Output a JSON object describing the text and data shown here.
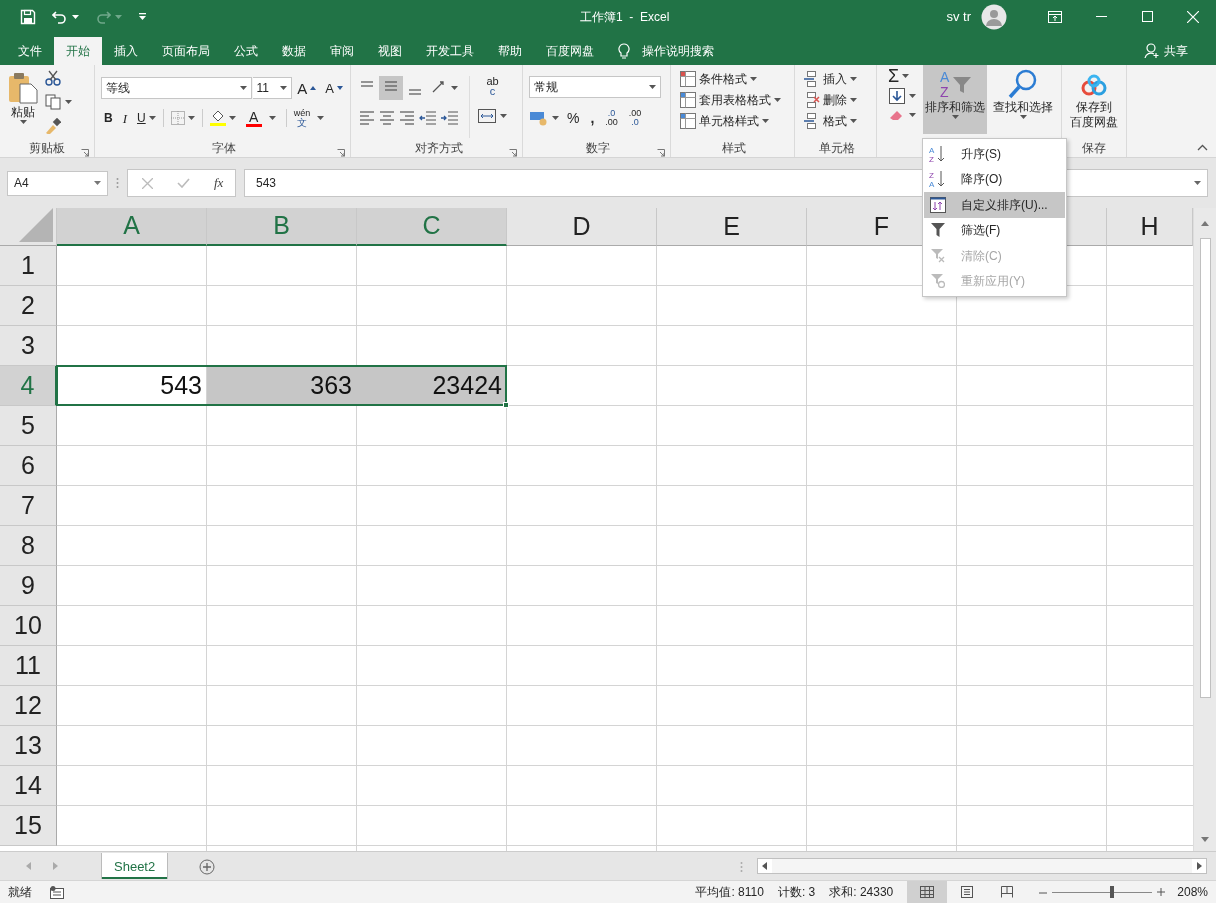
{
  "title_bar": {
    "title": "工作簿1  -  Excel",
    "user": "sv tr"
  },
  "ribbon_tabs": [
    {
      "label": "文件",
      "selected": false
    },
    {
      "label": "开始",
      "selected": true
    },
    {
      "label": "插入",
      "selected": false
    },
    {
      "label": "页面布局",
      "selected": false
    },
    {
      "label": "公式",
      "selected": false
    },
    {
      "label": "数据",
      "selected": false
    },
    {
      "label": "审阅",
      "selected": false
    },
    {
      "label": "视图",
      "selected": false
    },
    {
      "label": "开发工具",
      "selected": false
    },
    {
      "label": "帮助",
      "selected": false
    },
    {
      "label": "百度网盘",
      "selected": false
    }
  ],
  "tell_me": "操作说明搜索",
  "share": "共享",
  "ribbon": {
    "clipboard": {
      "paste": "粘贴",
      "label": "剪贴板"
    },
    "font": {
      "font_name": "等线",
      "font_size": "11",
      "grow": "A",
      "shrink": "A",
      "bold": "B",
      "italic": "I",
      "underline": "U",
      "font_color": "A",
      "phonetic": [
        "wén",
        "文"
      ],
      "label": "字体"
    },
    "alignment": {
      "wrap": [
        "ab",
        "c"
      ],
      "label": "对齐方式"
    },
    "number": {
      "format": "常规",
      "percent": "%",
      "comma": ",",
      "increase_decimal": [
        ".0",
        ".00"
      ],
      "decrease_decimal": [
        ".00",
        ".0"
      ],
      "label": "数字"
    },
    "styles": {
      "items": [
        "条件格式",
        "套用表格格式",
        "单元格样式"
      ],
      "label": "样式"
    },
    "cells": {
      "items": [
        "插入",
        "删除",
        "格式"
      ],
      "label": "单元格"
    },
    "editing": {
      "sum": "Σ",
      "sort_filter": {
        "label": "排序和筛选",
        "letters": [
          "A",
          "Z"
        ],
        "expanded": true
      },
      "find": "查找和选择"
    },
    "save": {
      "button": [
        "保存到",
        "百度网盘"
      ],
      "label": "保存"
    }
  },
  "sort_menu": [
    {
      "kind": "ascending",
      "label": "升序(S)",
      "letters": [
        "A",
        "Z"
      ],
      "selected": false,
      "disabled": false
    },
    {
      "kind": "descending",
      "label": "降序(O)",
      "letters": [
        "Z",
        "A"
      ],
      "selected": false,
      "disabled": false
    },
    {
      "kind": "custom",
      "label": "自定义排序(U)...",
      "selected": true,
      "disabled": false
    },
    {
      "kind": "filter",
      "label": "筛选(F)",
      "selected": false,
      "disabled": false
    },
    {
      "kind": "clear",
      "label": "清除(C)",
      "selected": false,
      "disabled": true
    },
    {
      "kind": "reapply",
      "label": "重新应用(Y)",
      "selected": false,
      "disabled": true
    }
  ],
  "formula_bar": {
    "name_box": "A4",
    "fx": "fx",
    "formula": "543"
  },
  "sheet": {
    "columns": [
      {
        "label": "A",
        "selected": true
      },
      {
        "label": "B",
        "selected": true
      },
      {
        "label": "C",
        "selected": true
      },
      {
        "label": "D",
        "selected": false
      },
      {
        "label": "E",
        "selected": false
      },
      {
        "label": "F",
        "selected": false
      },
      {
        "selected": false
      },
      {
        "label": "H",
        "selected": false
      }
    ],
    "rows": [
      {
        "label": "1",
        "selected": false
      },
      {
        "label": "2",
        "selected": false
      },
      {
        "label": "3",
        "selected": false
      },
      {
        "label": "4",
        "selected": true,
        "cells": [
          {
            "value": "543",
            "active": true
          },
          {
            "value": "363",
            "active": false
          },
          {
            "value": "23424",
            "active": false
          }
        ]
      },
      {
        "label": "5",
        "selected": false
      },
      {
        "label": "6",
        "selected": false
      },
      {
        "label": "7",
        "selected": false
      },
      {
        "label": "8",
        "selected": false
      },
      {
        "label": "9",
        "selected": false
      },
      {
        "label": "10",
        "selected": false
      },
      {
        "label": "11",
        "selected": false
      },
      {
        "label": "12",
        "selected": false
      },
      {
        "label": "13",
        "selected": false
      },
      {
        "label": "14",
        "selected": false
      },
      {
        "label": "15",
        "selected": false
      }
    ]
  },
  "sheet_tabs": [
    {
      "label": "Sheet2",
      "selected": true
    }
  ],
  "status_bar": {
    "mode": "就绪",
    "average": "平均值: 8110",
    "count": "计数: 3",
    "sum": "求和: 24330",
    "views": [
      {
        "kind": "normal",
        "selected": true
      },
      {
        "kind": "page_layout",
        "selected": false
      },
      {
        "kind": "page_break",
        "selected": false
      }
    ],
    "zoom": {
      "level": 0.6,
      "reading": "208%"
    }
  }
}
